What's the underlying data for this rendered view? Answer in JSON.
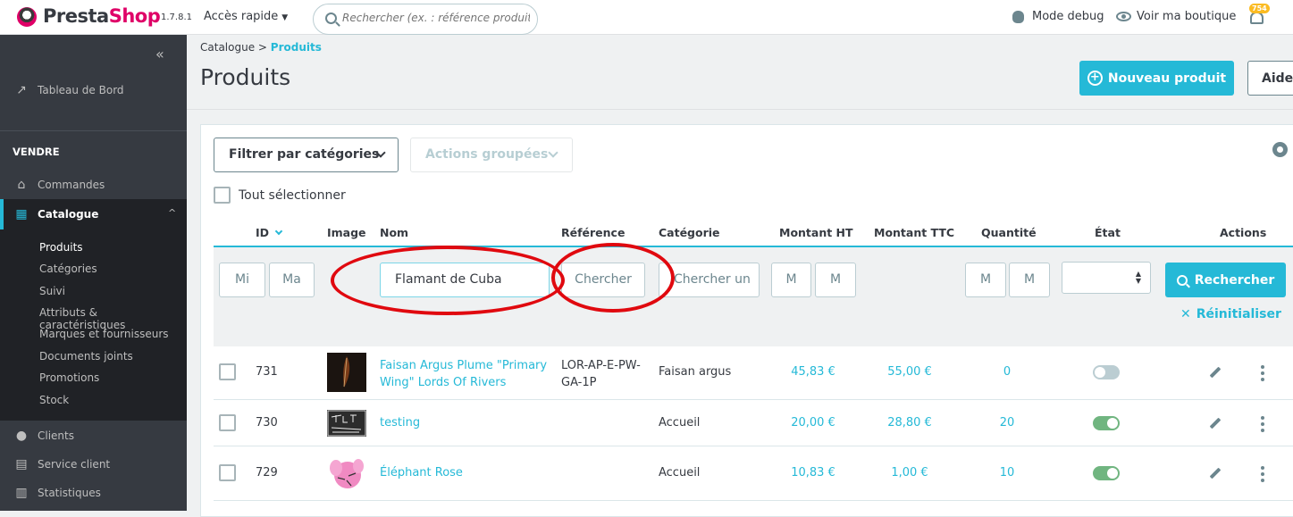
{
  "header": {
    "brand_pre": "Presta",
    "brand_post": "Shop",
    "version": "1.7.8.1",
    "quick_access": "Accès rapide",
    "search_placeholder": "Rechercher (ex. : référence produit, no",
    "debug": "Mode debug",
    "view_shop": "Voir ma boutique",
    "notifications": "754"
  },
  "sidebar": {
    "dashboard": "Tableau de Bord",
    "section": "VENDRE",
    "orders": "Commandes",
    "catalog": "Catalogue",
    "sub": [
      "Produits",
      "Catégories",
      "Suivi",
      "Attributs & caractéristiques",
      "Marques et fournisseurs",
      "Documents joints",
      "Promotions",
      "Stock"
    ],
    "customers": "Clients",
    "service": "Service client",
    "stats": "Statistiques"
  },
  "page": {
    "crumb_parent": "Catalogue",
    "crumb_sep": ">",
    "crumb_current": "Produits",
    "title": "Produits",
    "new_product": "Nouveau produit",
    "help": "Aide"
  },
  "toolbar": {
    "filter_categories": "Filtrer par catégories",
    "bulk_actions": "Actions groupées",
    "select_all": "Tout sélectionner"
  },
  "table": {
    "headers": [
      "ID",
      "Image",
      "Nom",
      "Référence",
      "Catégorie",
      "Montant HT",
      "Montant TTC",
      "Quantité",
      "État",
      "Actions"
    ],
    "filters": {
      "id_min": "Mi",
      "id_max": "Ma",
      "name": "Flamant de Cuba",
      "reference": "Chercher",
      "category": "Chercher un",
      "ht_min": "M",
      "ht_max": "M",
      "qty_min": "M",
      "qty_max": "M",
      "search_button": "Rechercher",
      "reset": "Réinitialiser"
    },
    "rows": [
      {
        "id": "731",
        "name_l1": "Faisan Argus Plume \"Primary",
        "name_l2": "Wing\" Lords Of Rivers",
        "ref_l1": "LOR-AP-E-PW-",
        "ref_l2": "GA-1P",
        "category": "Faisan argus",
        "ht": "45,83 €",
        "ttc": "55,00 €",
        "qty": "0",
        "active": false
      },
      {
        "id": "730",
        "name_l1": "testing",
        "name_l2": "",
        "ref_l1": "",
        "ref_l2": "",
        "category": "Accueil",
        "ht": "20,00 €",
        "ttc": "28,80 €",
        "qty": "20",
        "active": true
      },
      {
        "id": "729",
        "name_l1": "Éléphant Rose",
        "name_l2": "",
        "ref_l1": "",
        "ref_l2": "",
        "category": "Accueil",
        "ht": "10,83 €",
        "ttc": "1,00 €",
        "qty": "10",
        "active": true
      }
    ]
  },
  "colors": {
    "accent": "#25b9d7",
    "sidebar": "#363a41",
    "brand_pink": "#df0067",
    "annotation_red": "#e0090f",
    "toggle_on": "#70b580"
  }
}
